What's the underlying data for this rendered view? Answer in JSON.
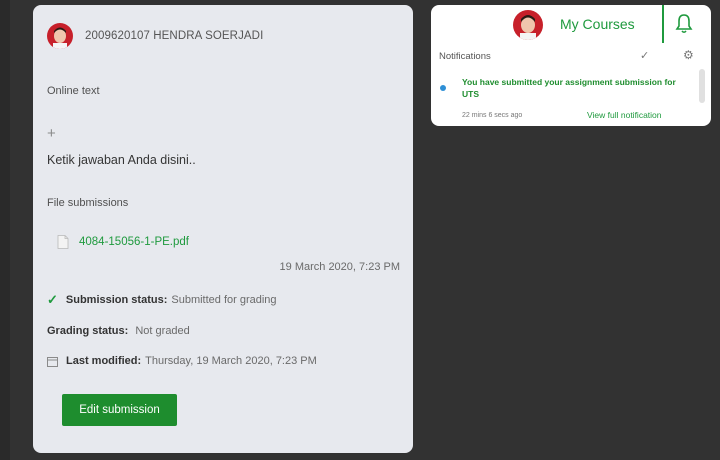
{
  "submission": {
    "user_name": "2009620107 HENDRA SOERJADI",
    "online_text_label": "Online text",
    "answer_text": "Ketik jawaban Anda disini..",
    "file_submissions_label": "File submissions",
    "file_name": "4084-15056-1-PE.pdf",
    "file_date": "19 March 2020, 7:23 PM",
    "status_label": "Submission status:",
    "status_value": "Submitted for grading",
    "grading_label": "Grading status:",
    "grading_value": "Not graded",
    "modified_label": "Last modified:",
    "modified_value": "Thursday, 19 March 2020, 7:23 PM",
    "edit_button": "Edit submission"
  },
  "navbar": {
    "my_courses": "My Courses"
  },
  "notifications": {
    "heading": "Notifications",
    "message": "You have submitted your assignment submission for UTS",
    "time": "22 mins 6 secs ago",
    "view_link": "View full notification"
  },
  "colors": {
    "accent_green": "#1e8d2e",
    "background": "#323232",
    "card": "#e7e9ee"
  }
}
